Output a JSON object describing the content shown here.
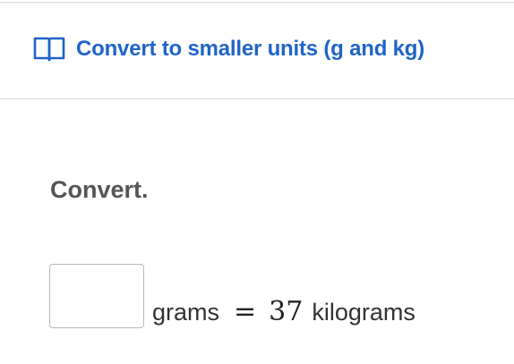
{
  "header": {
    "icon": "book-icon",
    "title": "Convert to smaller units (g and kg)",
    "color": "#1f64c7"
  },
  "question": {
    "prompt": "Convert.",
    "answer_value": "",
    "left_unit": "grams",
    "equals_sign": "=",
    "given_value": "37",
    "right_unit": "kilograms"
  }
}
